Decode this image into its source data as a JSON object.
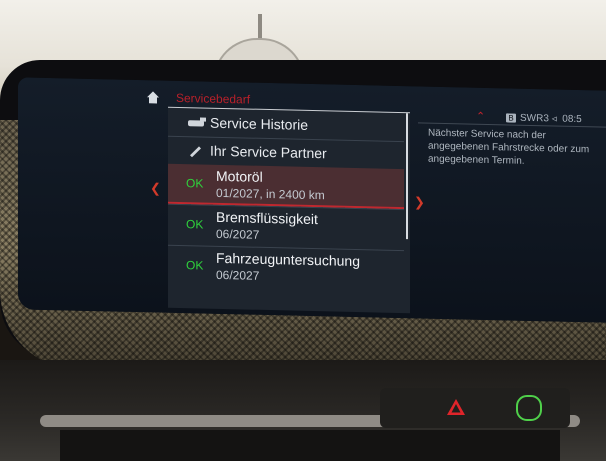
{
  "header": {
    "breadcrumb": "Servicebedarf"
  },
  "menu": [
    {
      "label": "Service Historie",
      "icon": "car-service-icon"
    },
    {
      "label": "Ihr Service Partner",
      "icon": "wrench-icon"
    }
  ],
  "service_items": [
    {
      "status": "OK",
      "title": "Motoröl",
      "detail": "01/2027, in 2400 km",
      "selected": true
    },
    {
      "status": "OK",
      "title": "Bremsflüssigkeit",
      "detail": "06/2027",
      "selected": false
    },
    {
      "status": "OK",
      "title": "Fahrzeuguntersuchung",
      "detail": "06/2027",
      "selected": false
    }
  ],
  "status_bar": {
    "radio_badge": "B",
    "station": "SWR3",
    "time": "08:5"
  },
  "info_panel": {
    "text": "Nächster Service nach der angegebenen Fahrstrecke oder zum angegebenen Termin."
  },
  "colors": {
    "accent_red": "#c0282f",
    "ok_green": "#2fd13c"
  }
}
